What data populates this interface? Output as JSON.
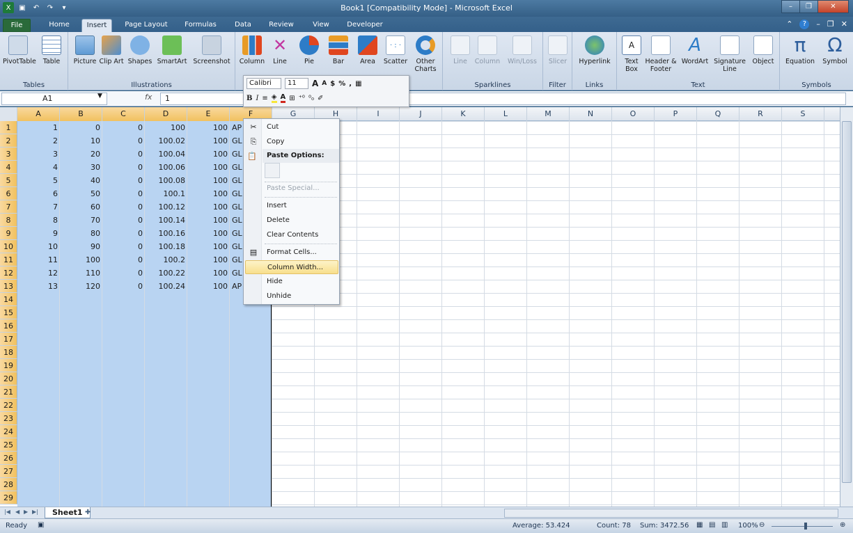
{
  "window": {
    "title": "Book1  [Compatibility Mode]  -  Microsoft Excel"
  },
  "qat": {
    "min": "–",
    "restore": "❐",
    "close": "✕"
  },
  "tabs": [
    {
      "label": "File"
    },
    {
      "label": "Home"
    },
    {
      "label": "Insert"
    },
    {
      "label": "Page Layout"
    },
    {
      "label": "Formulas"
    },
    {
      "label": "Data"
    },
    {
      "label": "Review"
    },
    {
      "label": "View"
    },
    {
      "label": "Developer"
    }
  ],
  "ribbon": {
    "groups": {
      "tables": "Tables",
      "illustrations": "Illustrations",
      "sparklines": "Sparklines",
      "filter": "Filter",
      "links": "Links",
      "text": "Text",
      "symbols": "Symbols"
    },
    "buttons": {
      "pivottable": "PivotTable",
      "table": "Table",
      "picture": "Picture",
      "clipart": "Clip Art",
      "shapes": "Shapes",
      "smartart": "SmartArt",
      "screenshot": "Screenshot",
      "column": "Column",
      "line": "Line",
      "pie": "Pie",
      "bar": "Bar",
      "area": "Area",
      "scatter": "Scatter",
      "othercharts": "Other Charts",
      "spark_line": "Line",
      "spark_column": "Column",
      "spark_winloss": "Win/Loss",
      "slicer": "Slicer",
      "hyperlink": "Hyperlink",
      "textbox": "Text Box",
      "headerfooter": "Header & Footer",
      "wordart": "WordArt",
      "signature": "Signature Line",
      "object": "Object",
      "equation": "Equation",
      "symbol": "Symbol"
    }
  },
  "mini": {
    "font": "Calibri",
    "size": "11",
    "grow": "A",
    "shrink": "A",
    "currency": "$",
    "percent": "%",
    "comma": ",",
    "bold": "B",
    "italic": "I"
  },
  "formula_bar": {
    "name_box": "A1",
    "fx": "fx",
    "value": "1"
  },
  "columns": [
    "A",
    "B",
    "C",
    "D",
    "E",
    "F",
    "G",
    "H",
    "I",
    "J",
    "K",
    "L",
    "M",
    "N",
    "O",
    "P",
    "Q",
    "R",
    "S"
  ],
  "rows": [
    "1",
    "2",
    "3",
    "4",
    "5",
    "6",
    "7",
    "8",
    "9",
    "10",
    "11",
    "12",
    "13",
    "14",
    "15",
    "16",
    "17",
    "18",
    "19",
    "20",
    "21",
    "22",
    "23",
    "24",
    "25",
    "26",
    "27",
    "28",
    "29"
  ],
  "data": [
    [
      "1",
      "0",
      "0",
      "100",
      "100",
      "AP"
    ],
    [
      "2",
      "10",
      "0",
      "100.02",
      "100",
      "GL"
    ],
    [
      "3",
      "20",
      "0",
      "100.04",
      "100",
      "GL"
    ],
    [
      "4",
      "30",
      "0",
      "100.06",
      "100",
      "GL"
    ],
    [
      "5",
      "40",
      "0",
      "100.08",
      "100",
      "GL"
    ],
    [
      "6",
      "50",
      "0",
      "100.1",
      "100",
      "GL"
    ],
    [
      "7",
      "60",
      "0",
      "100.12",
      "100",
      "GL"
    ],
    [
      "8",
      "70",
      "0",
      "100.14",
      "100",
      "GL"
    ],
    [
      "9",
      "80",
      "0",
      "100.16",
      "100",
      "GL"
    ],
    [
      "10",
      "90",
      "0",
      "100.18",
      "100",
      "GL"
    ],
    [
      "11",
      "100",
      "0",
      "100.2",
      "100",
      "GL"
    ],
    [
      "12",
      "110",
      "0",
      "100.22",
      "100",
      "GL"
    ],
    [
      "13",
      "120",
      "0",
      "100.24",
      "100",
      "AP"
    ]
  ],
  "context_menu": {
    "cut": "Cut",
    "copy": "Copy",
    "paste_options": "Paste Options:",
    "paste_special": "Paste Special...",
    "insert": "Insert",
    "delete": "Delete",
    "clear_contents": "Clear Contents",
    "format_cells": "Format Cells...",
    "column_width": "Column Width...",
    "hide": "Hide",
    "unhide": "Unhide"
  },
  "sheet": {
    "tab": "Sheet1"
  },
  "status": {
    "ready": "Ready",
    "average": "Average: 53.424",
    "count": "Count: 78",
    "sum": "Sum: 3472.56",
    "zoom": "100%"
  },
  "colors": {
    "selection": "#b9d4f2",
    "header_sel": "#f1c15f",
    "ribbon": "#dfe7f2"
  }
}
